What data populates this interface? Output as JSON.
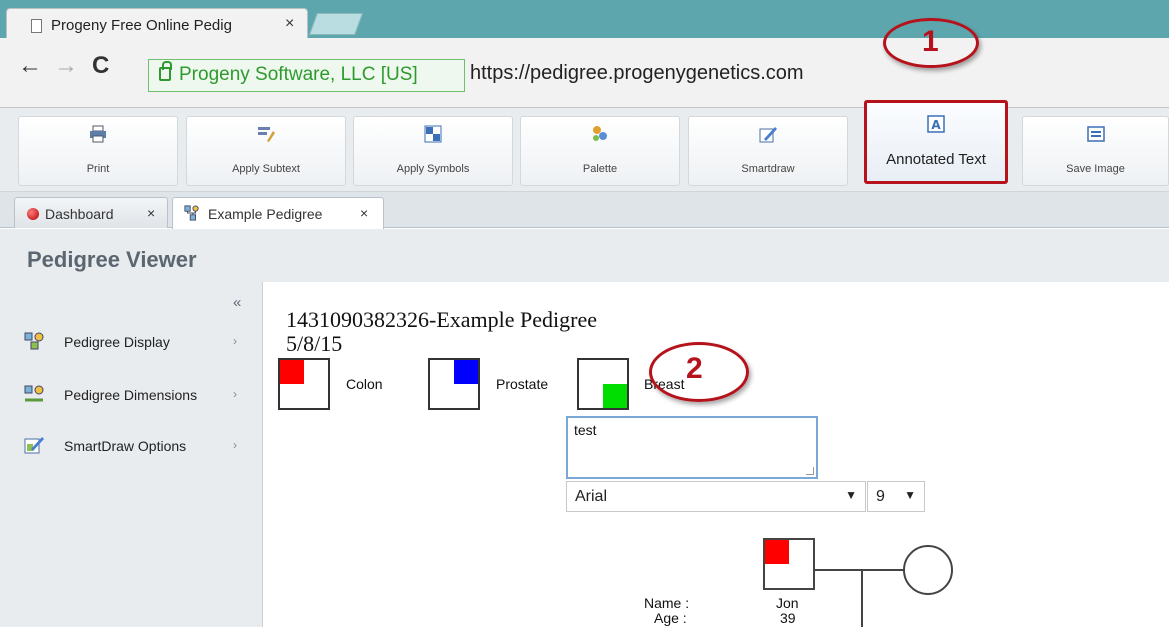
{
  "browser": {
    "tab_title": "Progeny Free Online Pedig",
    "tab_close": "×",
    "secure_label": "Progeny Software, LLC [US]",
    "url": "https://pedigree.progenygenetics.com",
    "back_icon": "←",
    "forward_icon": "→",
    "reload_icon": "C"
  },
  "app_toolbar": {
    "buttons": [
      {
        "label": "Print",
        "icon": "printer-icon"
      },
      {
        "label": "Apply Subtext",
        "icon": "subtext-icon"
      },
      {
        "label": "Apply Symbols",
        "icon": "symbols-icon"
      },
      {
        "label": "Palette",
        "icon": "palette-icon"
      },
      {
        "label": "Smartdraw",
        "icon": "smartdraw-icon"
      },
      {
        "label": "Annotated Text",
        "icon": "annotated-text-icon"
      },
      {
        "label": "Save Image",
        "icon": "save-image-icon"
      }
    ]
  },
  "app_tabs": [
    {
      "label": "Dashboard",
      "close": "×"
    },
    {
      "label": "Example Pedigree",
      "close": "×"
    }
  ],
  "viewer": {
    "title": "Pedigree Viewer",
    "collapse_icon": "«"
  },
  "sidebar": {
    "items": [
      {
        "label": "Pedigree Display",
        "arrow": "›"
      },
      {
        "label": "Pedigree Dimensions",
        "arrow": "›"
      },
      {
        "label": "SmartDraw Options",
        "arrow": "›"
      }
    ]
  },
  "pedigree": {
    "title": "1431090382326-Example Pedigree",
    "date": "5/8/15",
    "legend": [
      {
        "label": "Colon",
        "color": "#ff0000"
      },
      {
        "label": "Prostate",
        "color": "#0000ff"
      },
      {
        "label": "Breast",
        "color": "#00dd00"
      }
    ],
    "annotation_text": "test",
    "font_select": "Arial",
    "size_select": "9",
    "person": {
      "name_label": "Name :",
      "age_label": "Age :",
      "name_value": "Jon",
      "age_value": "39"
    }
  },
  "callouts": {
    "one": "1",
    "two": "2"
  },
  "colors": {
    "accent_red": "#b5121b",
    "tab_strip": "#5ea6ad"
  }
}
